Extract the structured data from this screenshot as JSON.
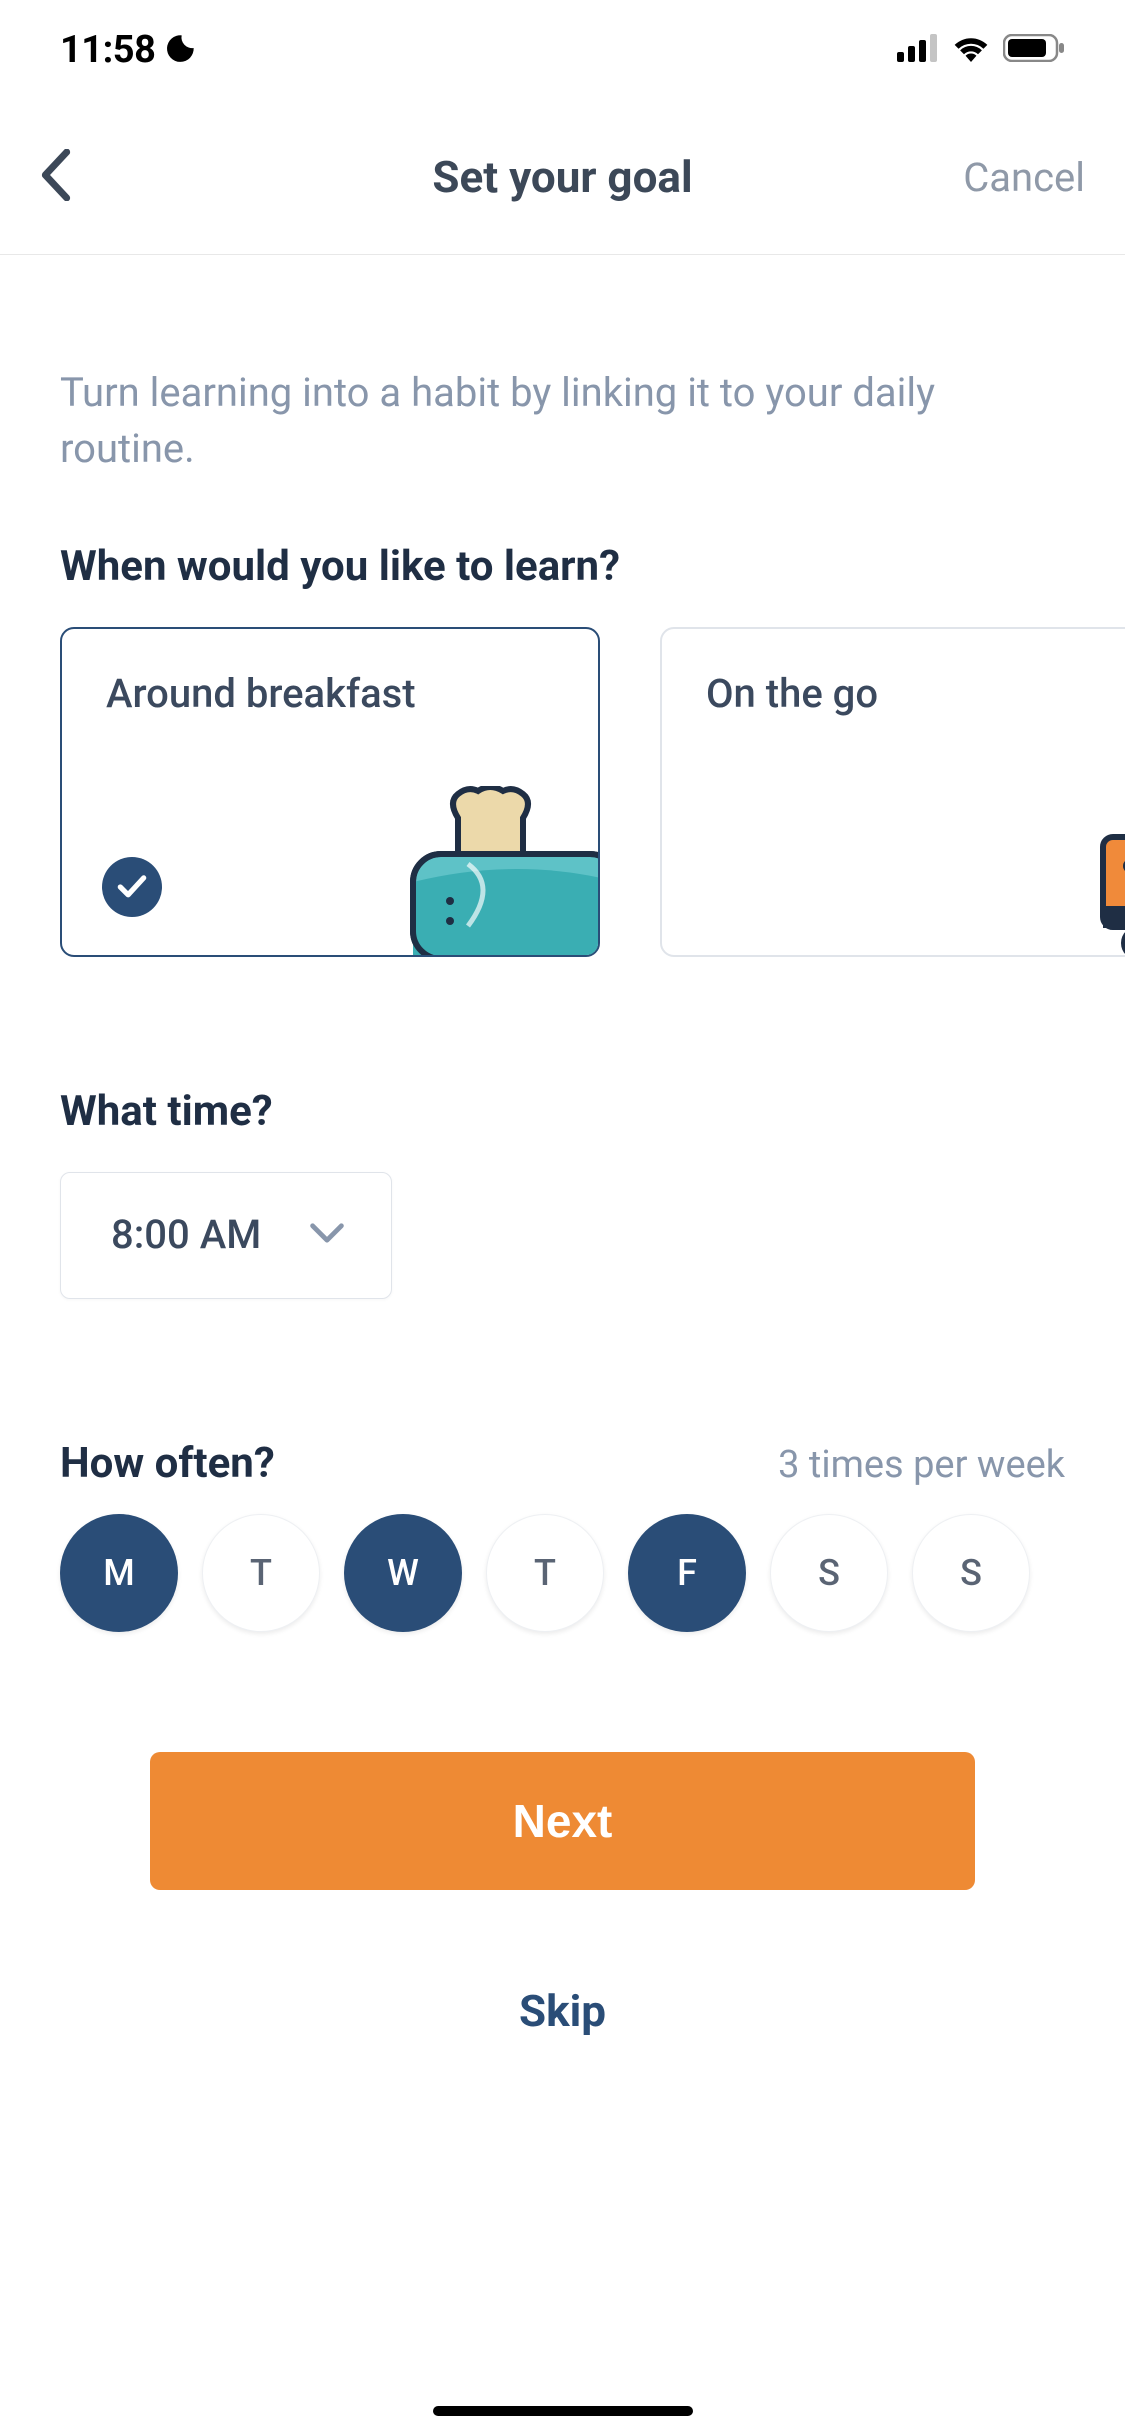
{
  "status": {
    "time": "11:58"
  },
  "nav": {
    "title": "Set your goal",
    "cancel": "Cancel"
  },
  "intro": "Turn learning into a habit by linking it to your daily routine.",
  "q_when": "When would you like to learn?",
  "options": {
    "breakfast": "Around breakfast",
    "on_go": "On the go"
  },
  "q_time": "What time?",
  "time_value": "8:00 AM",
  "q_often": "How often?",
  "often_summary": "3 times per week",
  "days": [
    {
      "label": "M",
      "on": true
    },
    {
      "label": "T",
      "on": false
    },
    {
      "label": "W",
      "on": true
    },
    {
      "label": "T",
      "on": false
    },
    {
      "label": "F",
      "on": true
    },
    {
      "label": "S",
      "on": false
    },
    {
      "label": "S",
      "on": false
    }
  ],
  "next_label": "Next",
  "skip_label": "Skip"
}
